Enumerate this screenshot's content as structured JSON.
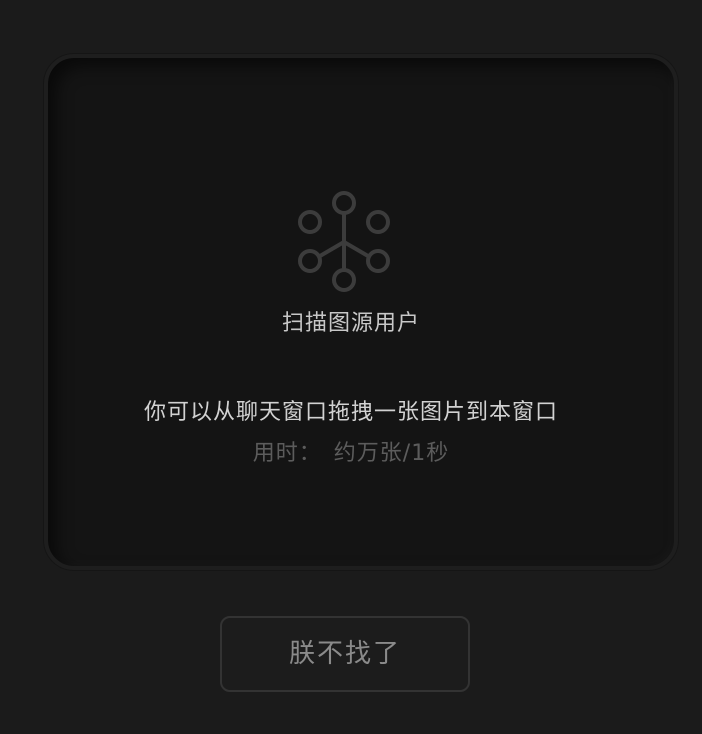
{
  "scan": {
    "icon": "network-nodes-icon",
    "title": "扫描图源用户"
  },
  "hint": {
    "drop_text": "你可以从聊天窗口拖拽一张图片到本窗口",
    "time_label": "用时：",
    "time_value": "约万张/1秒"
  },
  "actions": {
    "give_up_label": "朕不找了"
  },
  "colors": {
    "background": "#1b1b1b",
    "card": "#141414",
    "icon_stroke": "#3c3c3c",
    "button_border": "#333333"
  }
}
